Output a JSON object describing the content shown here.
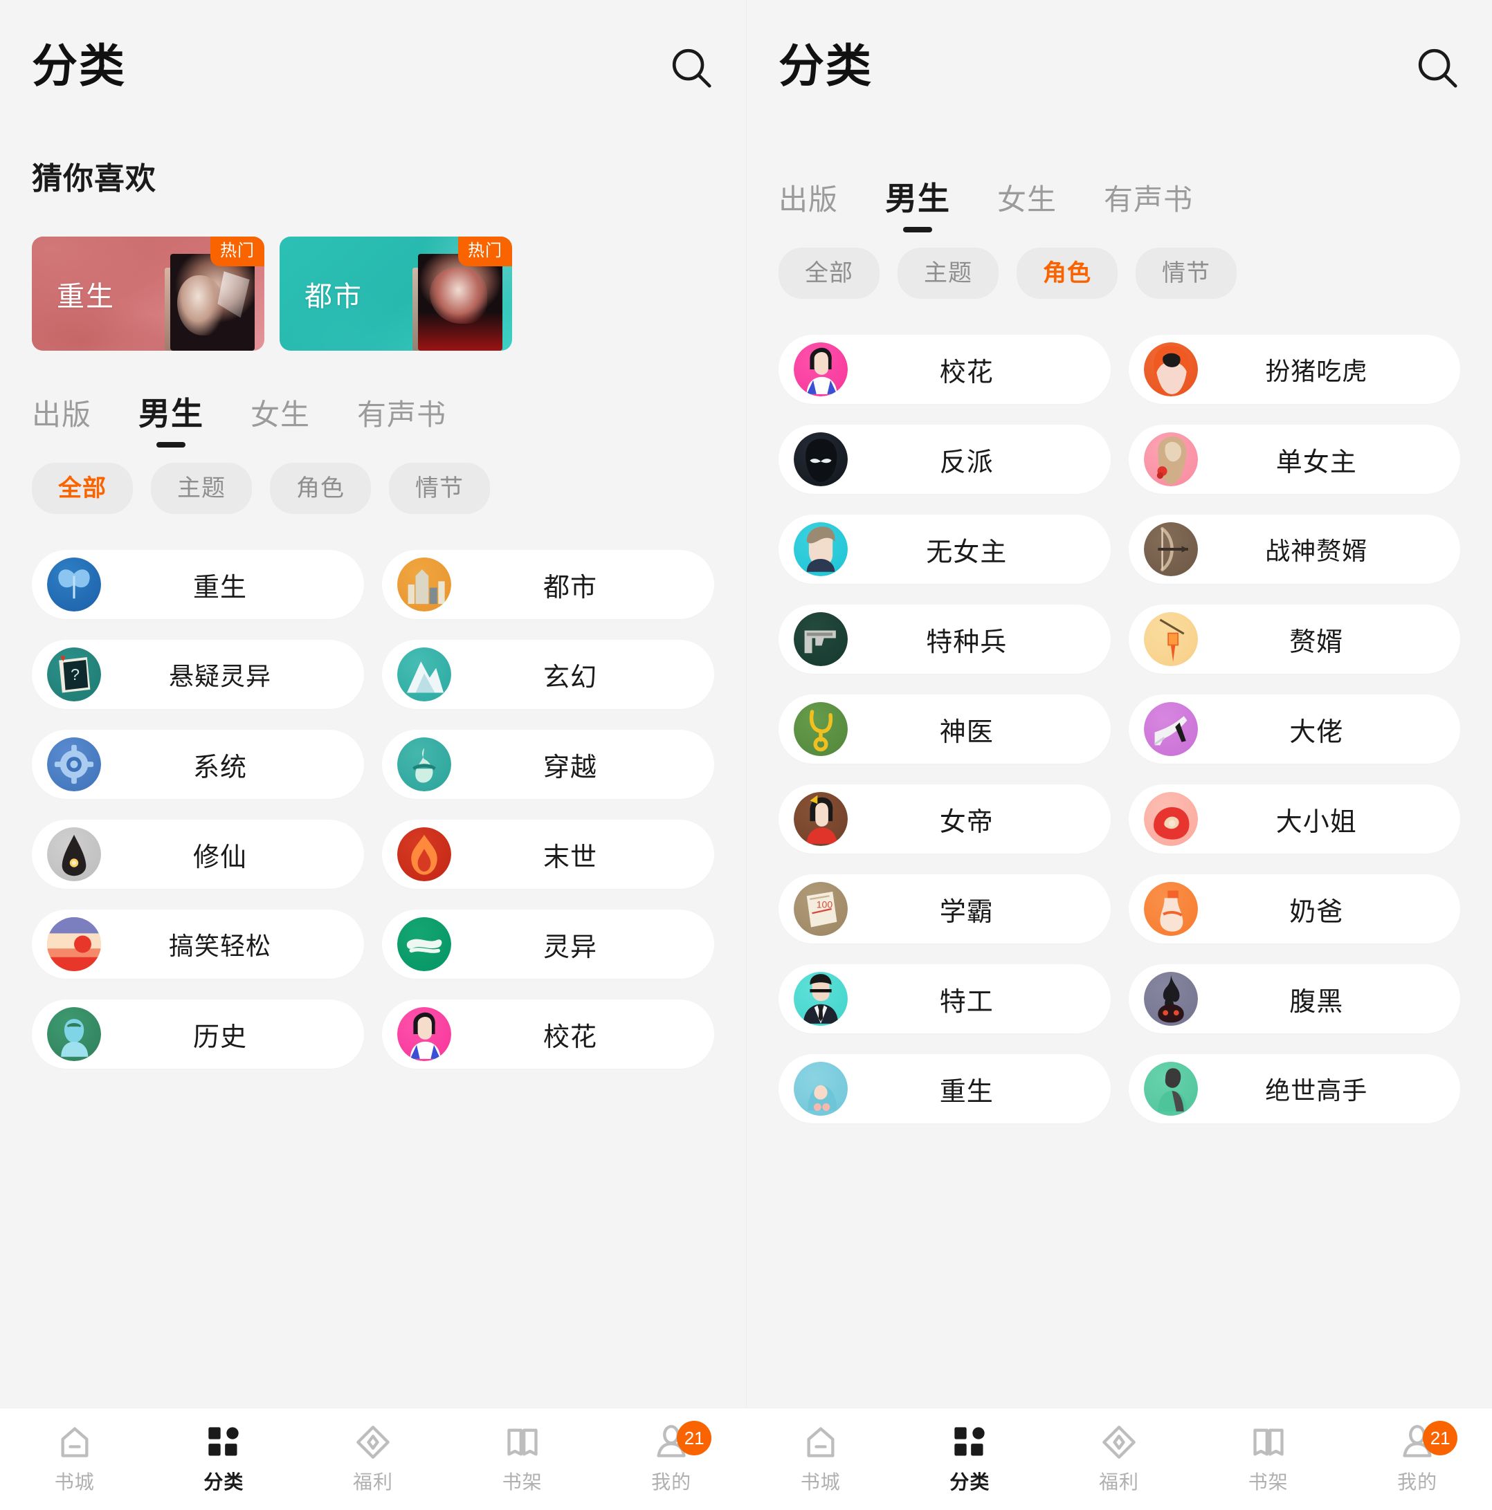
{
  "app": {
    "background_color": "#f4f4f4",
    "accent_color": "#fa6400",
    "card_color": "#ffffff"
  },
  "left_panel": {
    "header": {
      "title": "分类",
      "search_icon": "search-icon"
    },
    "section_title": "猜你喜欢",
    "banners": [
      {
        "label": "重生",
        "badge": "热门",
        "theme": "#c96a6c"
      },
      {
        "label": "都市",
        "badge": "热门",
        "theme": "#2cc0b4"
      }
    ],
    "tabs": [
      {
        "label": "出版",
        "active": false
      },
      {
        "label": "男生",
        "active": true
      },
      {
        "label": "女生",
        "active": false
      },
      {
        "label": "有声书",
        "active": false
      }
    ],
    "chips": [
      {
        "label": "全部",
        "active": true
      },
      {
        "label": "主题",
        "active": false
      },
      {
        "label": "角色",
        "active": false
      },
      {
        "label": "情节",
        "active": false
      }
    ],
    "categories": [
      {
        "label": "重生",
        "icon": "butterfly-icon",
        "c1": "#1b5fa8",
        "c2": "#2f7fc4",
        "shape": "butterfly"
      },
      {
        "label": "都市",
        "icon": "city-icon",
        "c1": "#e8932e",
        "c2": "#f0a63f",
        "shape": "city"
      },
      {
        "label": "悬疑灵异",
        "icon": "mystery-book-icon",
        "c1": "#1d7a72",
        "c2": "#2c9189",
        "shape": "book"
      },
      {
        "label": "玄幻",
        "icon": "mountain-icon",
        "c1": "#2aa8a0",
        "c2": "#46bdb4",
        "shape": "mountain"
      },
      {
        "label": "系统",
        "icon": "gear-icon",
        "c1": "#3e72b8",
        "c2": "#5a8bd0",
        "shape": "gear"
      },
      {
        "label": "穿越",
        "icon": "gourd-icon",
        "c1": "#2ba399",
        "c2": "#45b7ad",
        "shape": "gourd"
      },
      {
        "label": "修仙",
        "icon": "temple-icon",
        "c1": "#bcbcbc",
        "c2": "#cfcfcf",
        "shape": "temple"
      },
      {
        "label": "末世",
        "icon": "flame-icon",
        "c1": "#c32616",
        "c2": "#d63a22",
        "shape": "flame"
      },
      {
        "label": "搞笑轻松",
        "icon": "sunset-icon",
        "c1": "#f4c9a8",
        "c2": "#ef5b43",
        "shape": "sunset"
      },
      {
        "label": "灵异",
        "icon": "ghost-icon",
        "c1": "#069464",
        "c2": "#13a673",
        "shape": "ghost"
      },
      {
        "label": "历史",
        "icon": "scholar-icon",
        "c1": "#2f7f5c",
        "c2": "#3e9a70",
        "shape": "scholar"
      },
      {
        "label": "校花",
        "icon": "schoolgirl-icon",
        "c1": "#f8349a",
        "c2": "#fd52ab",
        "shape": "girl"
      }
    ]
  },
  "right_panel": {
    "header": {
      "title": "分类",
      "search_icon": "search-icon"
    },
    "tabs": [
      {
        "label": "出版",
        "active": false
      },
      {
        "label": "男生",
        "active": true
      },
      {
        "label": "女生",
        "active": false
      },
      {
        "label": "有声书",
        "active": false
      }
    ],
    "chips": [
      {
        "label": "全部",
        "active": false
      },
      {
        "label": "主题",
        "active": false
      },
      {
        "label": "角色",
        "active": true
      },
      {
        "label": "情节",
        "active": false
      }
    ],
    "categories": [
      {
        "label": "校花",
        "icon": "schoolgirl-icon",
        "c1": "#f8349a",
        "c2": "#fd52ab",
        "shape": "girl"
      },
      {
        "label": "扮猪吃虎",
        "icon": "redhead-icon",
        "c1": "#e8511d",
        "c2": "#f06a33",
        "shape": "redhead"
      },
      {
        "label": "反派",
        "icon": "villain-icon",
        "c1": "#12161c",
        "c2": "#242b35",
        "shape": "villain"
      },
      {
        "label": "单女主",
        "icon": "rose-girl-icon",
        "c1": "#f98a9e",
        "c2": "#fca3b3",
        "shape": "rosegirl"
      },
      {
        "label": "无女主",
        "icon": "boy-icon",
        "c1": "#1ec3d4",
        "c2": "#3ad2e0",
        "shape": "boy"
      },
      {
        "label": "战神赘婿",
        "icon": "bow-icon",
        "c1": "#6d5846",
        "c2": "#836c57",
        "shape": "bow"
      },
      {
        "label": "特种兵",
        "icon": "pistol-icon",
        "c1": "#17392f",
        "c2": "#24493d",
        "shape": "pistol"
      },
      {
        "label": "赘婿",
        "icon": "lantern-icon",
        "c1": "#f7cf86",
        "c2": "#fadc9f",
        "shape": "lantern"
      },
      {
        "label": "神医",
        "icon": "stethoscope-icon",
        "c1": "#52853a",
        "c2": "#669c4c",
        "shape": "stetho"
      },
      {
        "label": "大佬",
        "icon": "highheel-icon",
        "c1": "#c96ed6",
        "c2": "#d787e0",
        "shape": "heel"
      },
      {
        "label": "女帝",
        "icon": "empress-icon",
        "c1": "#70402a",
        "c2": "#875135",
        "shape": "empress"
      },
      {
        "label": "大小姐",
        "icon": "rose-icon",
        "c1": "#fba89c",
        "c2": "#fdbdb2",
        "shape": "rose"
      },
      {
        "label": "学霸",
        "icon": "test-paper-icon",
        "c1": "#9d8562",
        "c2": "#b09a78",
        "shape": "paper"
      },
      {
        "label": "奶爸",
        "icon": "baby-bottle-icon",
        "c1": "#f77a2e",
        "c2": "#fa9049",
        "shape": "bottle"
      },
      {
        "label": "特工",
        "icon": "agent-icon",
        "c1": "#3fd4cb",
        "c2": "#5fe0d8",
        "shape": "agent"
      },
      {
        "label": "腹黑",
        "icon": "dark-flame-icon",
        "c1": "#73738f",
        "c2": "#8686a0",
        "shape": "darkflame"
      },
      {
        "label": "重生",
        "icon": "reborn-icon",
        "c1": "#6fc5d8",
        "c2": "#8ad4e3",
        "shape": "reborn"
      },
      {
        "label": "绝世高手",
        "icon": "master-icon",
        "c1": "#4ec49a",
        "c2": "#68d2ac",
        "shape": "master"
      }
    ]
  },
  "bottom_nav": {
    "items": [
      {
        "label": "书城",
        "icon": "home-icon",
        "active": false,
        "badge": ""
      },
      {
        "label": "分类",
        "icon": "grid-icon",
        "active": true,
        "badge": ""
      },
      {
        "label": "福利",
        "icon": "gift-icon",
        "active": false,
        "badge": ""
      },
      {
        "label": "书架",
        "icon": "bookshelf-icon",
        "active": false,
        "badge": ""
      },
      {
        "label": "我的",
        "icon": "user-icon",
        "active": false,
        "badge": "21"
      }
    ]
  }
}
